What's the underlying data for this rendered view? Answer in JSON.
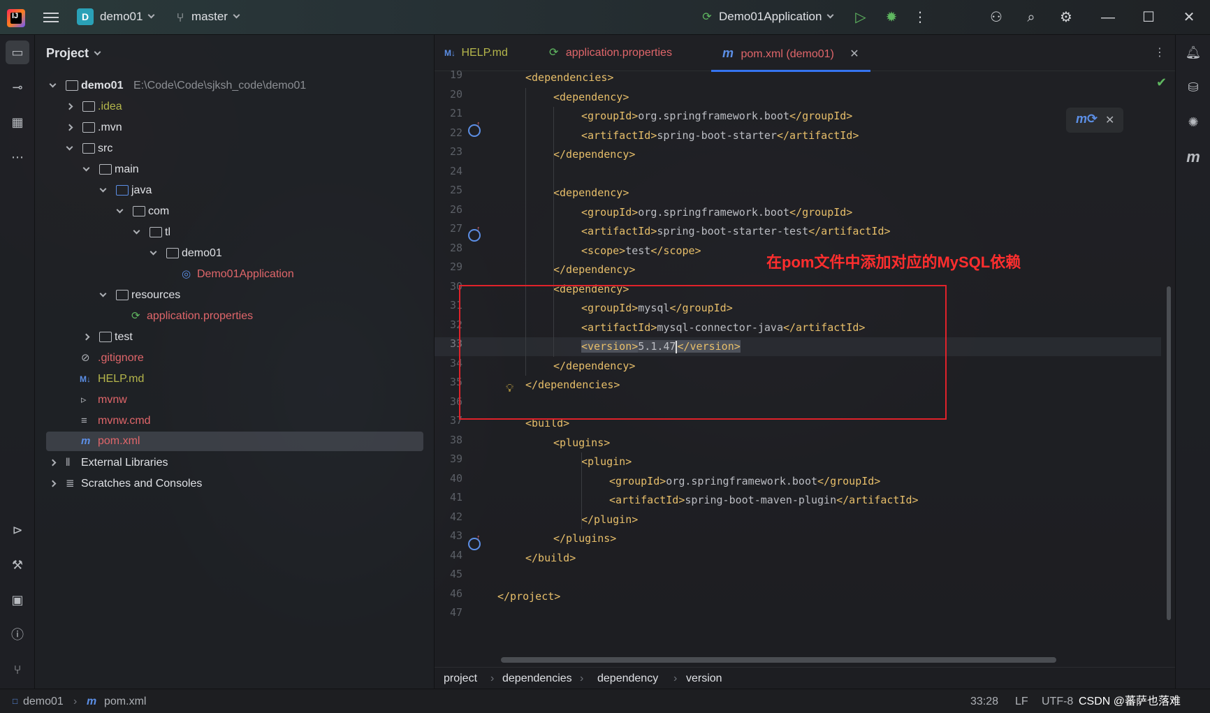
{
  "titlebar": {
    "app_logo": "IJ",
    "project_badge": "D",
    "project_name": "demo01",
    "branch_name": "master",
    "run_config": "Demo01Application"
  },
  "project_panel": {
    "title": "Project",
    "tree": [
      {
        "label": "demo01",
        "path": "E:\\Code\\Code\\sjksh_code\\demo01"
      },
      {
        "label": ".idea"
      },
      {
        "label": ".mvn"
      },
      {
        "label": "src"
      },
      {
        "label": "main"
      },
      {
        "label": "java"
      },
      {
        "label": "com"
      },
      {
        "label": "tl"
      },
      {
        "label": "demo01"
      },
      {
        "label": "Demo01Application"
      },
      {
        "label": "resources"
      },
      {
        "label": "application.properties"
      },
      {
        "label": "test"
      },
      {
        "label": ".gitignore"
      },
      {
        "label": "HELP.md"
      },
      {
        "label": "mvnw"
      },
      {
        "label": "mvnw.cmd"
      },
      {
        "label": "pom.xml"
      },
      {
        "label": "External Libraries"
      },
      {
        "label": "Scratches and Consoles"
      }
    ]
  },
  "editor": {
    "tabs": [
      {
        "label": "HELP.md",
        "icon": "M↓"
      },
      {
        "label": "application.properties",
        "icon": "spring-leaf-icon"
      },
      {
        "label": "pom.xml (demo01)",
        "icon": "m"
      }
    ],
    "line_numbers": [
      "19",
      "20",
      "21",
      "22",
      "23",
      "24",
      "25",
      "26",
      "27",
      "28",
      "29",
      "30",
      "31",
      "32",
      "33",
      "34",
      "35",
      "36",
      "37",
      "38",
      "39",
      "40",
      "41",
      "42",
      "43",
      "44",
      "45",
      "46",
      "47"
    ],
    "code_lines": {
      "l19": [
        "<dependencies>",
        ""
      ],
      "l20": [
        "<dependency>",
        ""
      ],
      "l21": [
        "<groupId>",
        "org.springframework.boot",
        "</groupId>"
      ],
      "l22": [
        "<artifactId>",
        "spring-boot-starter",
        "</artifactId>"
      ],
      "l23": [
        "</dependency>"
      ],
      "l25": [
        "<dependency>"
      ],
      "l26": [
        "<groupId>",
        "org.springframework.boot",
        "</groupId>"
      ],
      "l27": [
        "<artifactId>",
        "spring-boot-starter-test",
        "</artifactId>"
      ],
      "l28": [
        "<scope>",
        "test",
        "</scope>"
      ],
      "l29": [
        "</dependency>"
      ],
      "l30": [
        "<dependency>"
      ],
      "l31": [
        "<groupId>",
        "mysql",
        "</groupId>"
      ],
      "l32": [
        "<artifactId>",
        "mysql-connector-java",
        "</artifactId>"
      ],
      "l33": [
        "<version>",
        "5.1.47",
        "</version>"
      ],
      "l34": [
        "</dependency>"
      ],
      "l35": [
        "</dependencies>"
      ],
      "l37": [
        "<build>"
      ],
      "l38": [
        "<plugins>"
      ],
      "l39": [
        "<plugin>"
      ],
      "l40": [
        "<groupId>",
        "org.springframework.boot",
        "</groupId>"
      ],
      "l41": [
        "<artifactId>",
        "spring-boot-maven-plugin",
        "</artifactId>"
      ],
      "l42": [
        "</plugin>"
      ],
      "l43": [
        "</plugins>"
      ],
      "l44": [
        "</build>"
      ],
      "l46": [
        "</project>"
      ]
    },
    "annotation": "在pom文件中添加对应的MySQL依赖"
  },
  "breadcrumbs": [
    "project",
    "dependencies",
    "dependency",
    "version"
  ],
  "statusbar": {
    "project": "demo01",
    "file": "pom.xml",
    "position": "33:28",
    "line_sep": "LF",
    "encoding": "UTF-8",
    "watermark": "CSDN @蕃萨也落难"
  },
  "colors": {
    "accent": "#3574f0",
    "xml_tag": "#e8bf6a",
    "annotation_red": "#ff2e2e",
    "file_red": "#e0666a",
    "file_olive": "#b5b64b"
  }
}
